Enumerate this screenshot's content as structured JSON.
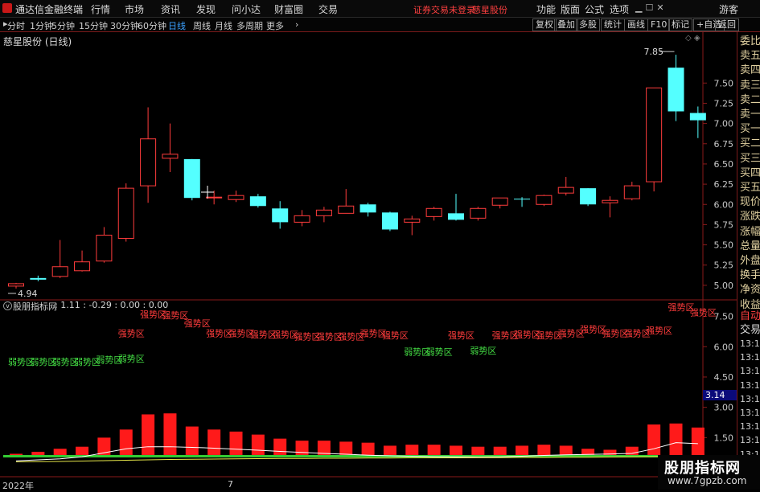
{
  "app": {
    "title": "通达信金融终端",
    "account_notice": "证券交易未登录",
    "stock_link": "慈星股份",
    "guest": "游客"
  },
  "menu": [
    "行情",
    "市场",
    "资讯",
    "发现",
    "问小达",
    "财富圈",
    "交易"
  ],
  "right_menu": [
    "功能",
    "版面",
    "公式",
    "选项"
  ],
  "periods": [
    {
      "label": "分时",
      "active": false
    },
    {
      "label": "1分钟",
      "active": false
    },
    {
      "label": "5分钟",
      "active": false
    },
    {
      "label": "15分钟",
      "active": false
    },
    {
      "label": "30分钟",
      "active": false
    },
    {
      "label": "60分钟",
      "active": false
    },
    {
      "label": "日线",
      "active": true
    },
    {
      "label": "周线",
      "active": false
    },
    {
      "label": "月线",
      "active": false
    },
    {
      "label": "多周期",
      "active": false
    },
    {
      "label": "更多",
      "active": false
    }
  ],
  "tools": [
    "复权",
    "叠加",
    "多股",
    "统计",
    "画线",
    "F10",
    "标记",
    "+自选",
    "返回"
  ],
  "chart_title": "慈星股份 (日线)",
  "indicator_header": {
    "name": "股朋指标网",
    "values": ": 1.11 : -0.29 : 0.00 : 0.00"
  },
  "right_panel": [
    "委比",
    "卖五",
    "卖四",
    "卖三",
    "卖二",
    "卖一",
    "买一",
    "买二",
    "买三",
    "买四",
    "买五",
    "现价",
    "涨跌",
    "涨幅",
    "总量",
    "外盘",
    "换手",
    "净资",
    "收益"
  ],
  "right_panel_lower": [
    "自动",
    "交易",
    "13:17",
    "13:17",
    "13:17",
    "13:17",
    "13:17",
    "13:17",
    "13:17",
    "13:17",
    "13:18"
  ],
  "x_labels": [
    "2022年",
    "7"
  ],
  "watermark": {
    "line1": "股朋指标网",
    "line2": "www.7gpzb.com"
  },
  "colors": {
    "up": "#ff3c3c",
    "down": "#54ffff",
    "weak": "#44dd44",
    "axis": "#8a1a1a"
  },
  "chart_data": [
    {
      "type": "candlestick",
      "title": "慈星股份 (日线)",
      "ylim": [
        4.85,
        7.95
      ],
      "y_ticks": [
        5.0,
        5.25,
        5.5,
        5.75,
        6.0,
        6.25,
        6.5,
        6.75,
        7.0,
        7.25,
        7.5
      ],
      "annotations": [
        {
          "label": "4.94",
          "value": 4.94
        },
        {
          "label": "7.85",
          "value": 7.85
        }
      ],
      "candles": [
        {
          "o": 4.99,
          "c": 5.02,
          "h": 5.03,
          "l": 4.96
        },
        {
          "o": 5.09,
          "c": 5.07,
          "h": 5.12,
          "l": 5.05
        },
        {
          "o": 5.11,
          "c": 5.23,
          "h": 5.56,
          "l": 5.09
        },
        {
          "o": 5.18,
          "c": 5.29,
          "h": 5.43,
          "l": 5.17
        },
        {
          "o": 5.3,
          "c": 5.62,
          "h": 5.72,
          "l": 5.28
        },
        {
          "o": 5.58,
          "c": 6.2,
          "h": 6.26,
          "l": 5.54
        },
        {
          "o": 6.23,
          "c": 6.81,
          "h": 7.2,
          "l": 6.02
        },
        {
          "o": 6.57,
          "c": 6.62,
          "h": 7.0,
          "l": 6.4
        },
        {
          "o": 6.56,
          "c": 6.08,
          "h": 6.56,
          "l": 6.05
        },
        {
          "o": 6.08,
          "c": 6.09,
          "h": 6.17,
          "l": 6.0
        },
        {
          "o": 6.06,
          "c": 6.11,
          "h": 6.17,
          "l": 6.03
        },
        {
          "o": 6.1,
          "c": 5.98,
          "h": 6.13,
          "l": 5.96
        },
        {
          "o": 5.95,
          "c": 5.78,
          "h": 6.04,
          "l": 5.7
        },
        {
          "o": 5.78,
          "c": 5.86,
          "h": 5.93,
          "l": 5.73
        },
        {
          "o": 5.86,
          "c": 5.93,
          "h": 5.97,
          "l": 5.78
        },
        {
          "o": 5.89,
          "c": 5.98,
          "h": 6.19,
          "l": 5.89
        },
        {
          "o": 6.0,
          "c": 5.9,
          "h": 6.02,
          "l": 5.85
        },
        {
          "o": 5.9,
          "c": 5.69,
          "h": 5.91,
          "l": 5.67
        },
        {
          "o": 5.78,
          "c": 5.82,
          "h": 5.86,
          "l": 5.62
        },
        {
          "o": 5.85,
          "c": 5.95,
          "h": 5.97,
          "l": 5.8
        },
        {
          "o": 5.89,
          "c": 5.81,
          "h": 6.13,
          "l": 5.8
        },
        {
          "o": 5.83,
          "c": 5.95,
          "h": 5.97,
          "l": 5.8
        },
        {
          "o": 5.99,
          "c": 6.08,
          "h": 6.08,
          "l": 5.95
        },
        {
          "o": 6.07,
          "c": 6.06,
          "h": 6.09,
          "l": 5.97
        },
        {
          "o": 6.0,
          "c": 6.11,
          "h": 6.12,
          "l": 5.98
        },
        {
          "o": 6.14,
          "c": 6.21,
          "h": 6.34,
          "l": 6.11
        },
        {
          "o": 6.2,
          "c": 6.0,
          "h": 6.2,
          "l": 5.98
        },
        {
          "o": 6.02,
          "c": 6.05,
          "h": 6.1,
          "l": 5.84
        },
        {
          "o": 6.07,
          "c": 6.23,
          "h": 6.28,
          "l": 6.05
        },
        {
          "o": 6.28,
          "c": 7.44,
          "h": 7.44,
          "l": 6.16
        },
        {
          "o": 7.69,
          "c": 7.15,
          "h": 7.85,
          "l": 7.03
        },
        {
          "o": 7.13,
          "c": 7.04,
          "h": 7.21,
          "l": 6.82
        }
      ]
    },
    {
      "type": "bar",
      "title": "股朋指标网",
      "ylim": [
        0.6,
        7.8
      ],
      "y_ticks": [
        1.5,
        3.0,
        4.5,
        6.0,
        7.5
      ],
      "last_value_label": "3.14",
      "values": [
        0.7,
        0.8,
        0.95,
        1.05,
        1.5,
        1.9,
        2.65,
        2.7,
        2.05,
        1.9,
        1.8,
        1.65,
        1.45,
        1.35,
        1.35,
        1.3,
        1.25,
        1.1,
        1.15,
        1.15,
        1.1,
        1.05,
        1.05,
        1.1,
        1.15,
        1.1,
        0.95,
        0.9,
        1.05,
        2.15,
        2.2,
        2.0
      ],
      "line_a": [
        0.35,
        0.4,
        0.45,
        0.55,
        0.75,
        0.95,
        1.05,
        1.05,
        1.02,
        0.98,
        0.93,
        0.88,
        0.82,
        0.77,
        0.72,
        0.68,
        0.63,
        0.6,
        0.58,
        0.56,
        0.55,
        0.54,
        0.55,
        0.58,
        0.62,
        0.65,
        0.67,
        0.69,
        0.72,
        0.95,
        1.25,
        1.2
      ],
      "line_b": [
        0.3,
        0.31,
        0.32,
        0.34,
        0.36,
        0.38,
        0.4,
        0.42,
        0.43,
        0.44,
        0.45,
        0.46,
        0.47,
        0.47,
        0.48,
        0.48,
        0.49,
        0.49,
        0.5,
        0.5,
        0.5,
        0.51,
        0.51,
        0.52,
        0.52,
        0.53,
        0.53,
        0.54,
        0.55,
        0.56,
        0.57
      ],
      "labels": [
        {
          "text": "弱势区",
          "i": 0,
          "y": 5.1,
          "kind": "weak"
        },
        {
          "text": "弱势区",
          "i": 1,
          "y": 5.1,
          "kind": "weak"
        },
        {
          "text": "弱势区",
          "i": 2,
          "y": 5.1,
          "kind": "weak"
        },
        {
          "text": "弱势区",
          "i": 3,
          "y": 5.1,
          "kind": "weak"
        },
        {
          "text": "弱势区",
          "i": 4,
          "y": 5.2,
          "kind": "weak"
        },
        {
          "text": "弱势区",
          "i": 5,
          "y": 5.25,
          "kind": "weak"
        },
        {
          "text": "强势区",
          "i": 5,
          "y": 6.5,
          "kind": "strong"
        },
        {
          "text": "强势区",
          "i": 6,
          "y": 7.45,
          "kind": "strong"
        },
        {
          "text": "强势区",
          "i": 7,
          "y": 7.4,
          "kind": "strong"
        },
        {
          "text": "强势区",
          "i": 8,
          "y": 7.0,
          "kind": "strong"
        },
        {
          "text": "强势区",
          "i": 9,
          "y": 6.5,
          "kind": "strong"
        },
        {
          "text": "强势区",
          "i": 10,
          "y": 6.5,
          "kind": "strong"
        },
        {
          "text": "强势区",
          "i": 11,
          "y": 6.45,
          "kind": "strong"
        },
        {
          "text": "强势区",
          "i": 12,
          "y": 6.45,
          "kind": "strong"
        },
        {
          "text": "强势区",
          "i": 13,
          "y": 6.35,
          "kind": "strong"
        },
        {
          "text": "强势区",
          "i": 14,
          "y": 6.35,
          "kind": "strong"
        },
        {
          "text": "强势区",
          "i": 15,
          "y": 6.35,
          "kind": "strong"
        },
        {
          "text": "强势区",
          "i": 16,
          "y": 6.5,
          "kind": "strong"
        },
        {
          "text": "强势区",
          "i": 17,
          "y": 6.4,
          "kind": "strong"
        },
        {
          "text": "弱势区",
          "i": 18,
          "y": 5.6,
          "kind": "weak"
        },
        {
          "text": "弱势区",
          "i": 19,
          "y": 5.6,
          "kind": "weak"
        },
        {
          "text": "强势区",
          "i": 20,
          "y": 6.4,
          "kind": "strong"
        },
        {
          "text": "弱势区",
          "i": 21,
          "y": 5.65,
          "kind": "weak"
        },
        {
          "text": "强势区",
          "i": 22,
          "y": 6.4,
          "kind": "strong"
        },
        {
          "text": "强势区",
          "i": 23,
          "y": 6.45,
          "kind": "strong"
        },
        {
          "text": "强势区",
          "i": 24,
          "y": 6.4,
          "kind": "strong"
        },
        {
          "text": "强势区",
          "i": 25,
          "y": 6.5,
          "kind": "strong"
        },
        {
          "text": "强势区",
          "i": 26,
          "y": 6.7,
          "kind": "strong"
        },
        {
          "text": "强势区",
          "i": 27,
          "y": 6.5,
          "kind": "strong"
        },
        {
          "text": "强势区",
          "i": 28,
          "y": 6.5,
          "kind": "strong"
        },
        {
          "text": "强势区",
          "i": 29,
          "y": 6.65,
          "kind": "strong"
        },
        {
          "text": "强势区",
          "i": 30,
          "y": 7.8,
          "kind": "strong"
        },
        {
          "text": "强势区",
          "i": 31,
          "y": 7.55,
          "kind": "strong"
        }
      ]
    }
  ]
}
